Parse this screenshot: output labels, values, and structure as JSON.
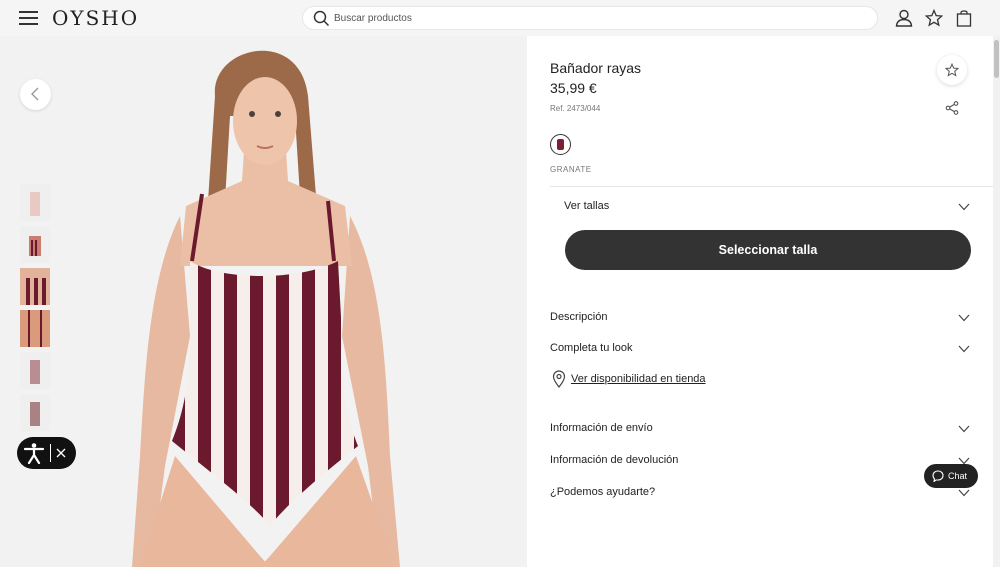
{
  "header": {
    "logo": "OYSHO",
    "search_placeholder": "Buscar productos"
  },
  "gallery": {
    "thumbnail_count": 6,
    "swimsuit_colors": [
      "#6b1a2d",
      "#f6eeea"
    ]
  },
  "product": {
    "name": "Bañador rayas",
    "price": "35,99 €",
    "reference": "Ref. 2473/044",
    "color_name": "GRANATE",
    "color_hex": "#7a1f34",
    "sizes_label": "Ver tallas",
    "select_size_button": "Seleccionar talla"
  },
  "accordion": {
    "description": "Descripción",
    "complete_look": "Completa tu look",
    "store_availability": "Ver disponibilidad en tienda",
    "shipping": "Información de envío",
    "returns": "Información de devolución",
    "help": "¿Podemos ayudarte?"
  },
  "chat": {
    "label": "Chat"
  }
}
